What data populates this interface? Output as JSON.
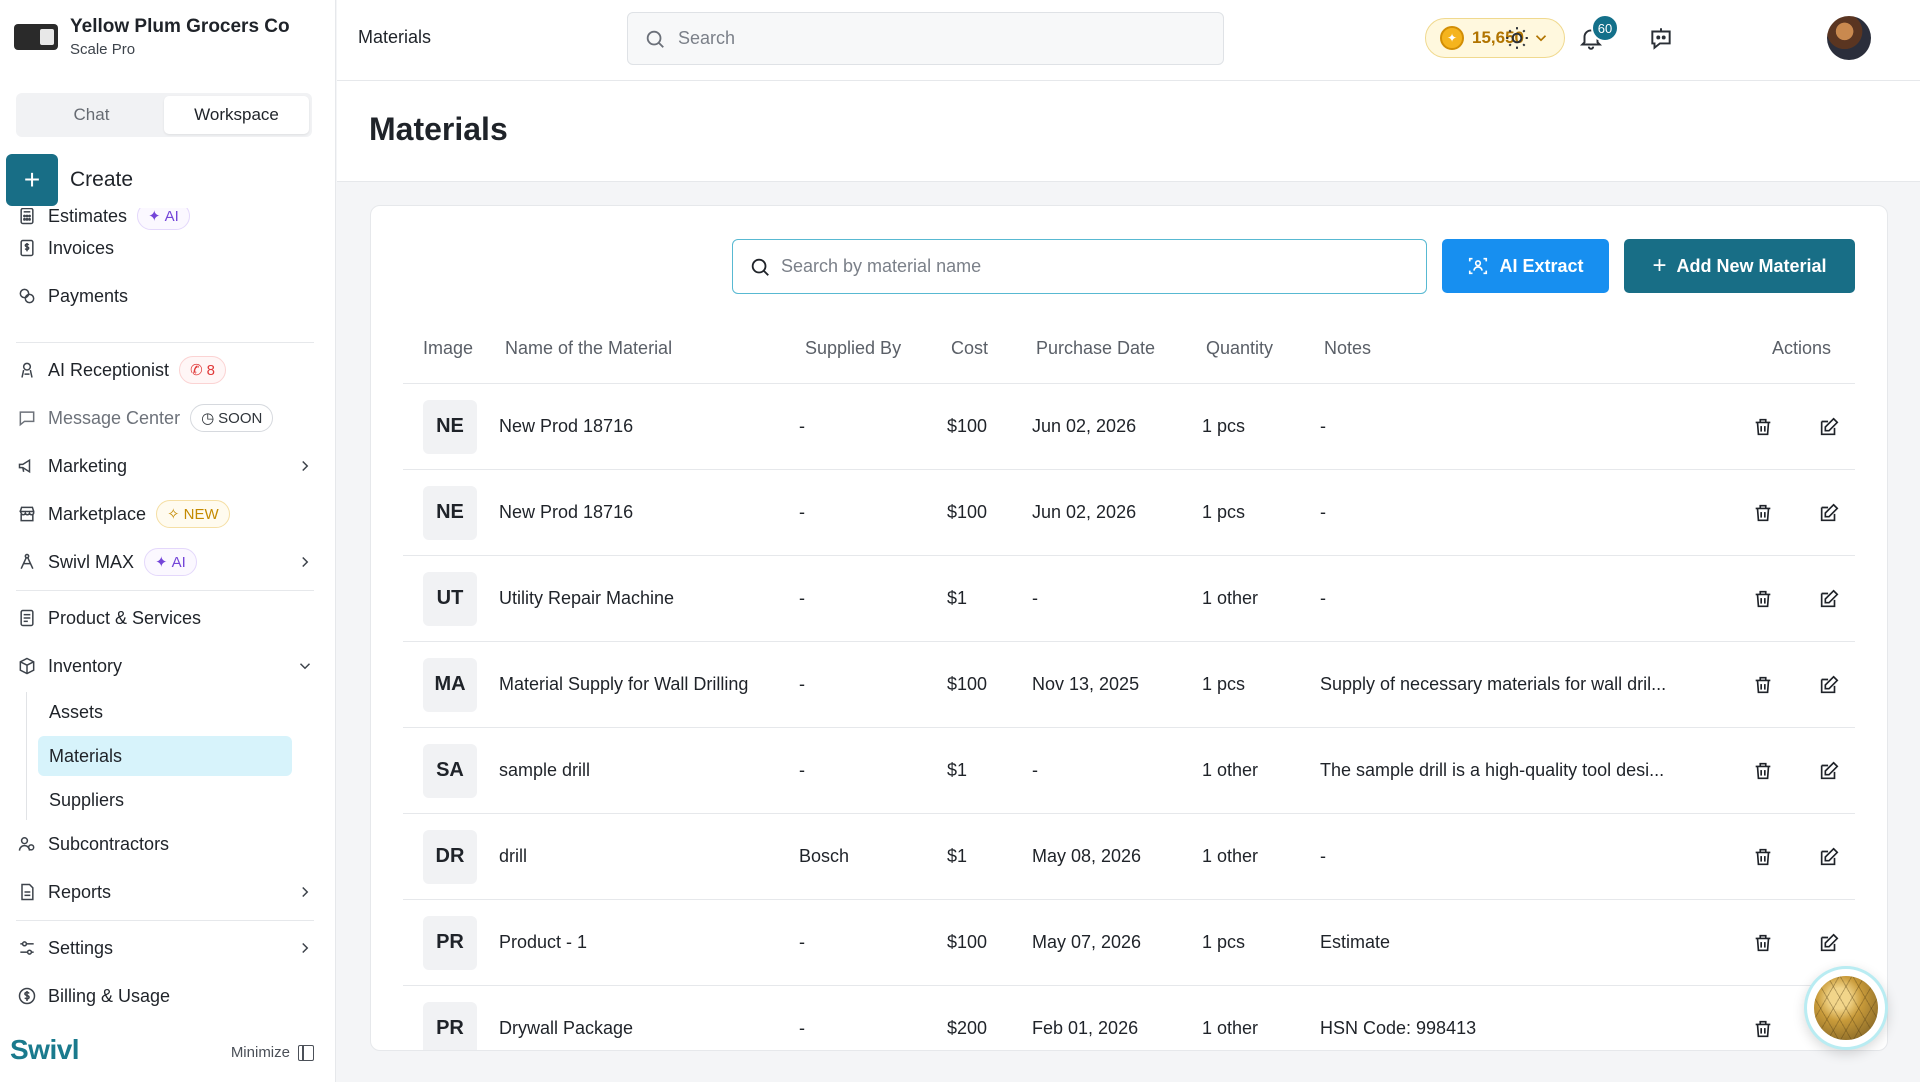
{
  "org": {
    "name": "Yellow Plum Grocers Co",
    "plan": "Scale Pro"
  },
  "mode_tabs": {
    "chat": "Chat",
    "workspace": "Workspace"
  },
  "create_label": "Create",
  "nav": {
    "estimates": "Estimates",
    "estimates_badge": "AI",
    "invoices": "Invoices",
    "payments": "Payments",
    "ai_receptionist": "AI Receptionist",
    "ai_receptionist_badge": "8",
    "message_center": "Message Center",
    "message_center_badge": "SOON",
    "marketing": "Marketing",
    "marketplace": "Marketplace",
    "marketplace_badge": "NEW",
    "swivl_max": "Swivl MAX",
    "swivl_max_badge": "AI",
    "product_services": "Product & Services",
    "inventory": "Inventory",
    "inventory_children": [
      "Assets",
      "Materials",
      "Suppliers"
    ],
    "subcontractors": "Subcontractors",
    "reports": "Reports",
    "settings": "Settings",
    "billing": "Billing & Usage"
  },
  "footer": {
    "brand": "Swivl",
    "minimize": "Minimize"
  },
  "topbar": {
    "breadcrumb": "Materials",
    "search_placeholder": "Search",
    "credits": "15,650",
    "notifications_count": "60"
  },
  "page": {
    "title": "Materials",
    "search_placeholder": "Search by material name",
    "ai_extract_label": "AI Extract",
    "add_label": "Add New Material"
  },
  "table": {
    "headers": {
      "image": "Image",
      "name": "Name of the Material",
      "supplier": "Supplied By",
      "cost": "Cost",
      "date": "Purchase Date",
      "qty": "Quantity",
      "notes": "Notes",
      "actions": "Actions"
    },
    "rows": [
      {
        "initials": "NE",
        "name": "New Prod 18716",
        "supplier": "-",
        "cost": "$100",
        "date": "Jun 02, 2026",
        "qty": "1 pcs",
        "notes": "-"
      },
      {
        "initials": "NE",
        "name": "New Prod 18716",
        "supplier": "-",
        "cost": "$100",
        "date": "Jun 02, 2026",
        "qty": "1 pcs",
        "notes": "-"
      },
      {
        "initials": "UT",
        "name": "Utility Repair Machine",
        "supplier": "-",
        "cost": "$1",
        "date": "-",
        "qty": "1 other",
        "notes": "-"
      },
      {
        "initials": "MA",
        "name": "Material Supply for Wall Drilling",
        "supplier": "-",
        "cost": "$100",
        "date": "Nov 13, 2025",
        "qty": "1 pcs",
        "notes": "Supply of necessary materials for wall dril..."
      },
      {
        "initials": "SA",
        "name": "sample drill",
        "supplier": "-",
        "cost": "$1",
        "date": "-",
        "qty": "1 other",
        "notes": "The sample drill is a high-quality tool desi..."
      },
      {
        "initials": "DR",
        "name": "drill",
        "supplier": "Bosch",
        "cost": "$1",
        "date": "May 08, 2026",
        "qty": "1 other",
        "notes": "-"
      },
      {
        "initials": "PR",
        "name": "Product - 1",
        "supplier": "-",
        "cost": "$100",
        "date": "May 07, 2026",
        "qty": "1 pcs",
        "notes": "Estimate"
      },
      {
        "initials": "PR",
        "name": "Drywall Package",
        "supplier": "-",
        "cost": "$200",
        "date": "Feb 01, 2026",
        "qty": "1 other",
        "notes": "HSN Code: 998413"
      }
    ]
  },
  "colors": {
    "primary": "#186e86",
    "ai_blue": "#178ff0",
    "active_nav": "#d7f3fb"
  }
}
